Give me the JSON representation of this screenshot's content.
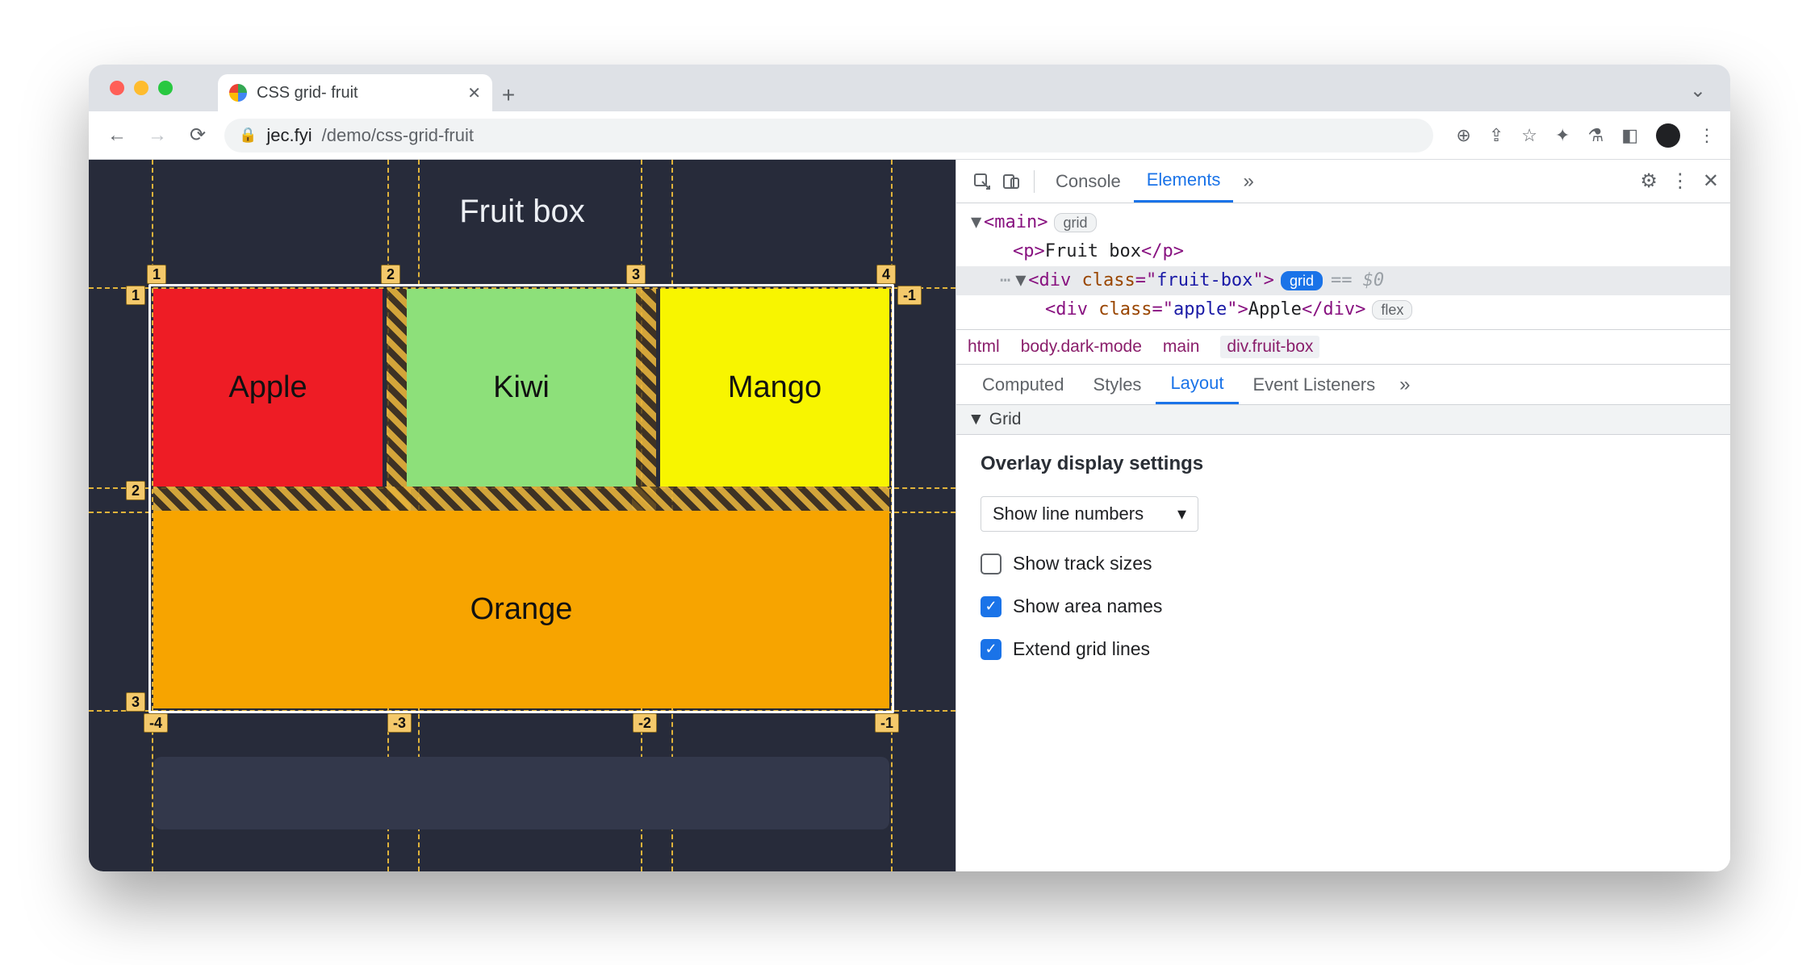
{
  "browser": {
    "tab_title": "CSS grid- fruit",
    "url_domain": "jec.fyi",
    "url_path": "/demo/css-grid-fruit"
  },
  "page": {
    "title": "Fruit box",
    "cells": {
      "apple": "Apple",
      "kiwi": "Kiwi",
      "mango": "Mango",
      "orange": "Orange"
    },
    "line_labels": {
      "top": [
        "1",
        "2",
        "3",
        "4"
      ],
      "left": [
        "1",
        "2",
        "3"
      ],
      "right_top": "-1",
      "bottom": [
        "-4",
        "-3",
        "-2",
        "-1"
      ]
    }
  },
  "devtools": {
    "tabs": {
      "console": "Console",
      "elements": "Elements"
    },
    "dom": {
      "main_open": "<main>",
      "main_badge": "grid",
      "p_open": "<p>",
      "p_text": "Fruit box",
      "p_close": "</p>",
      "div_open": "<div class=\"fruit-box\">",
      "div_badge": "grid",
      "div_marker": "== $0",
      "child_open": "<div class=\"apple\">",
      "child_text": "Apple",
      "child_close": "</div>",
      "child_badge": "flex"
    },
    "breadcrumb": [
      "html",
      "body.dark-mode",
      "main",
      "div.fruit-box"
    ],
    "sub_tabs": {
      "computed": "Computed",
      "styles": "Styles",
      "layout": "Layout",
      "event_listeners": "Event Listeners"
    },
    "grid_section": "Grid",
    "overlay_heading": "Overlay display settings",
    "dropdown": "Show line numbers",
    "checks": {
      "track_sizes": {
        "label": "Show track sizes",
        "checked": false
      },
      "area_names": {
        "label": "Show area names",
        "checked": true
      },
      "extend": {
        "label": "Extend grid lines",
        "checked": true
      }
    }
  }
}
